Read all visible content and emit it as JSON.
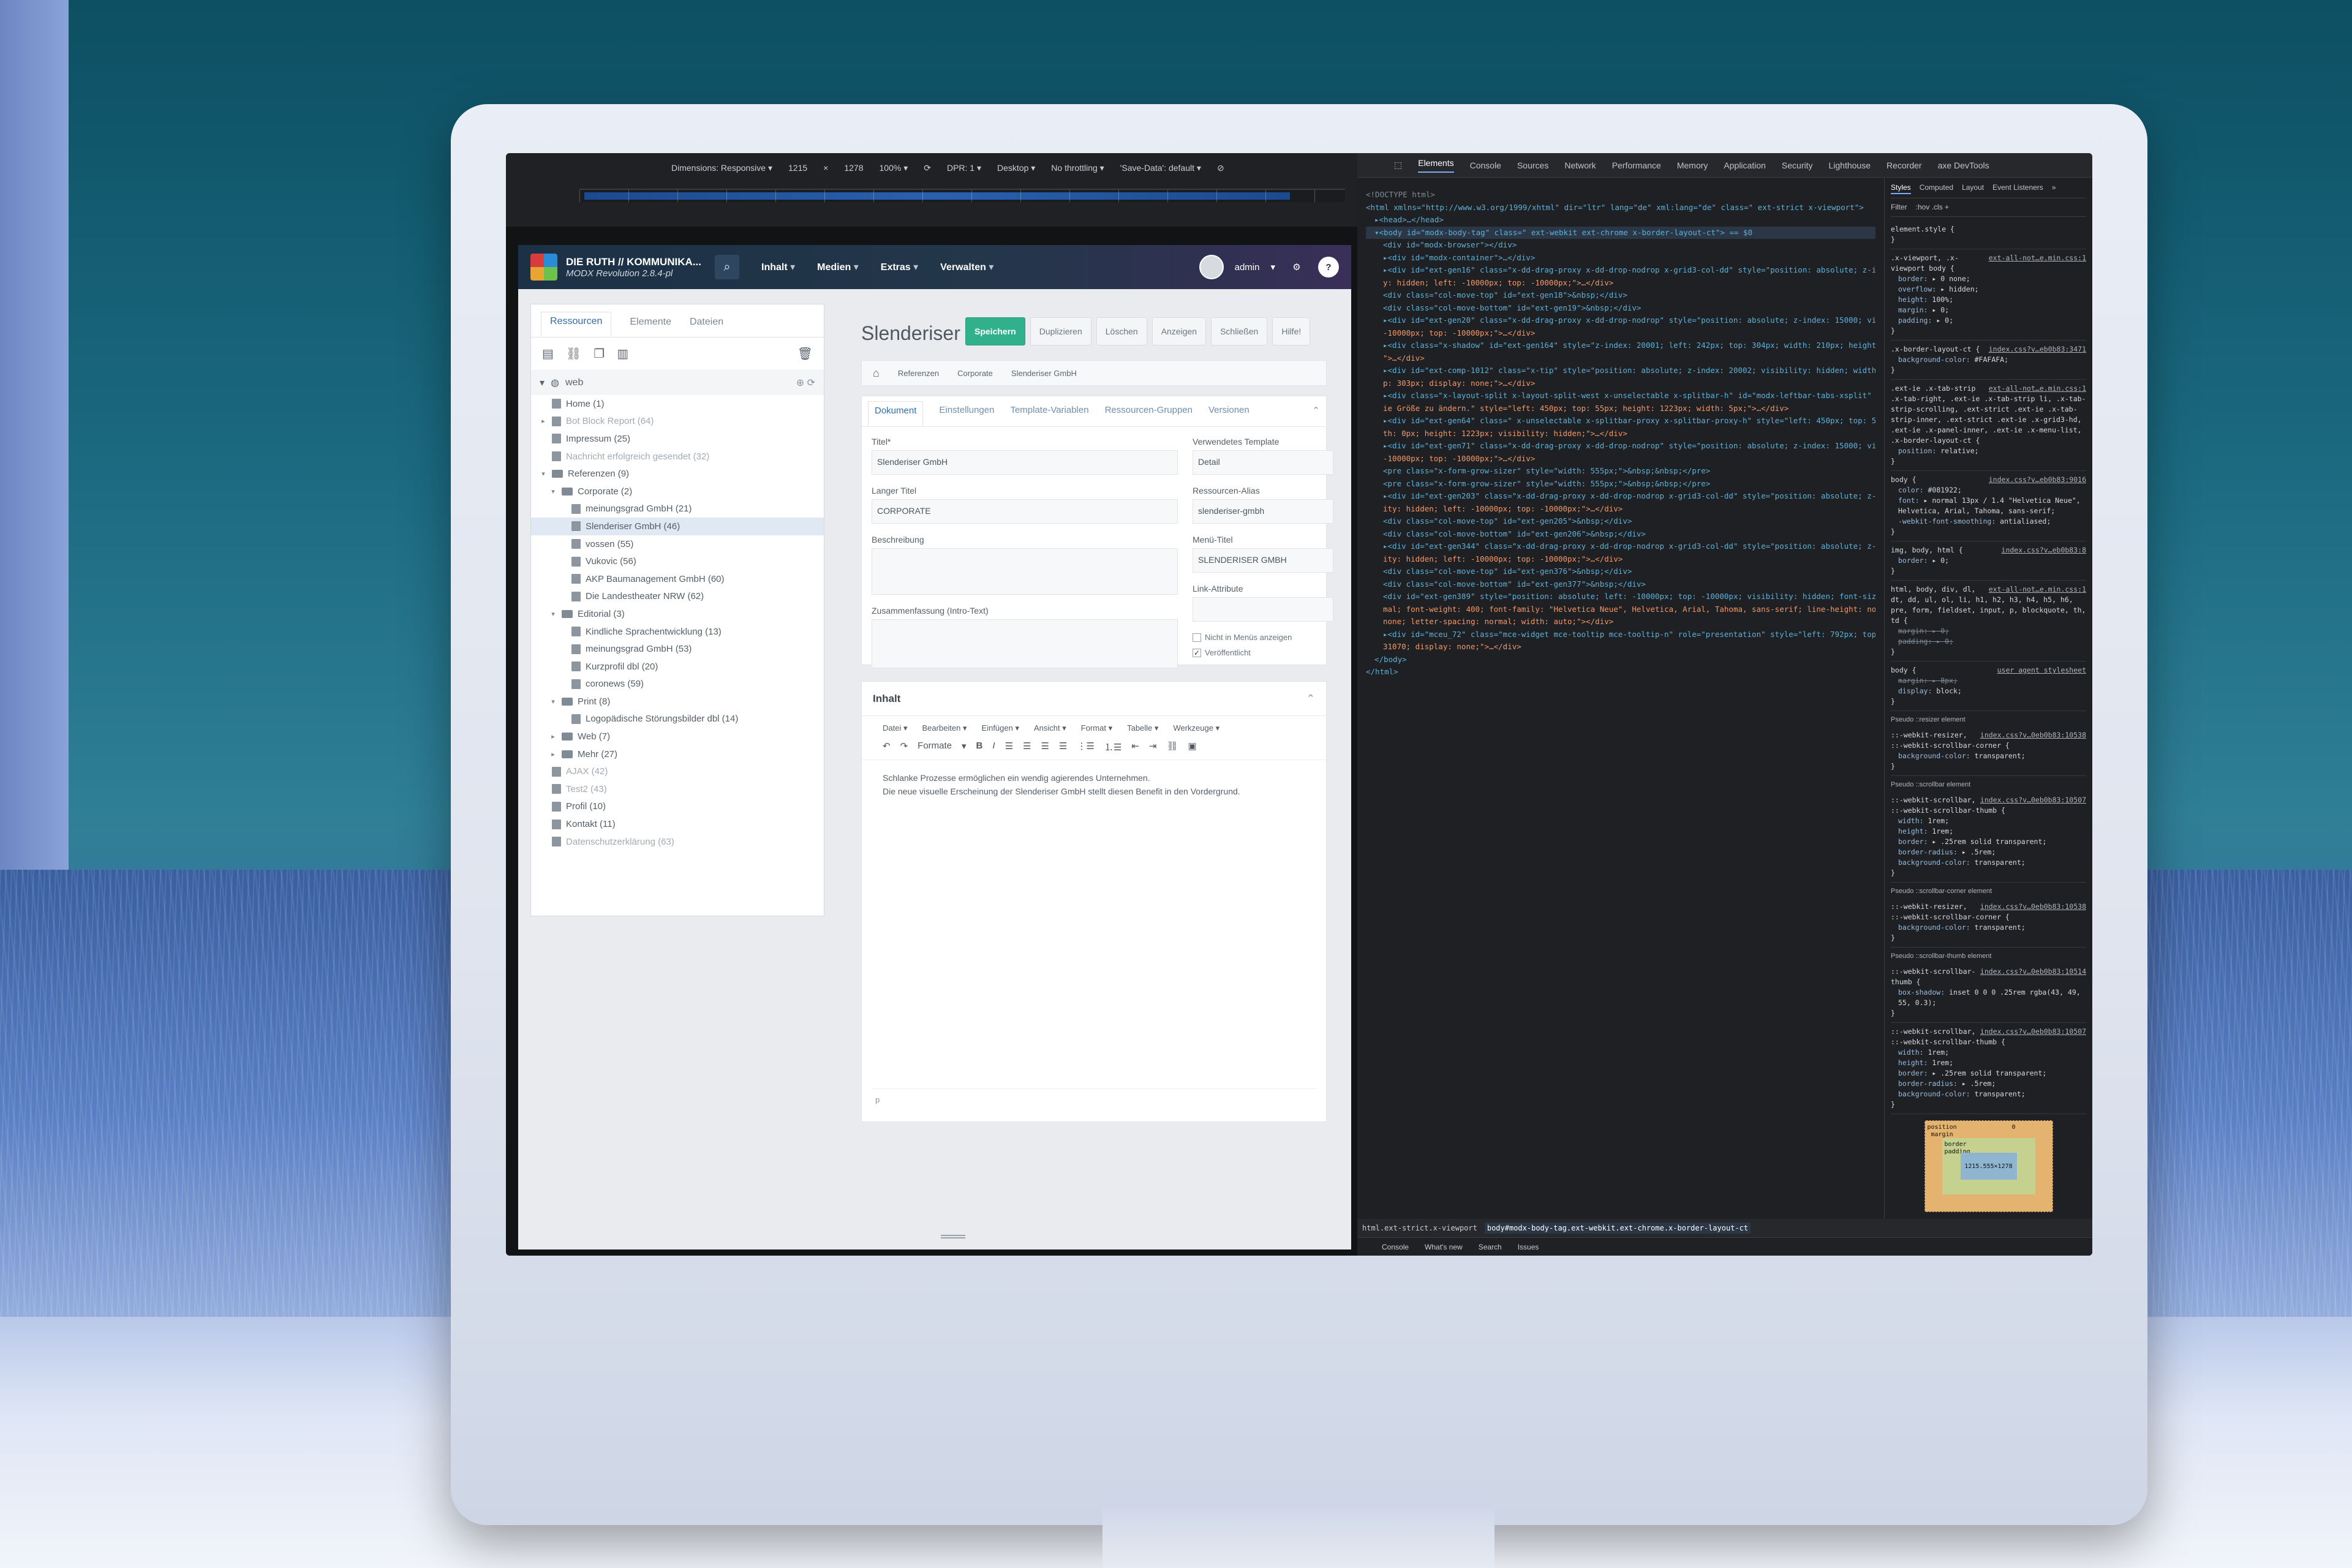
{
  "device_toolbar": {
    "dimensions_label": "Dimensions: Responsive ▾",
    "width": "1215",
    "times": "×",
    "height": "1278",
    "zoom": "100% ▾",
    "dpr": "DPR: 1 ▾",
    "device_type": "Desktop ▾",
    "throttling": "No throttling ▾",
    "save_data": "'Save-Data': default ▾"
  },
  "modx": {
    "brand_title": "DIE RUTH // KOMMUNIKA...",
    "brand_version": "MODX Revolution 2.8.4-pl",
    "nav": [
      "Inhalt",
      "Medien",
      "Extras",
      "Verwalten"
    ],
    "user": "admin",
    "help": "?"
  },
  "left_panel": {
    "tabs": [
      "Ressourcen",
      "Elemente",
      "Dateien"
    ],
    "root": "web",
    "tree": [
      {
        "label": "Home (1)",
        "level": 0,
        "type": "page",
        "muted": false,
        "arrow": ""
      },
      {
        "label": "Bot Block Report (64)",
        "level": 0,
        "type": "page",
        "muted": true,
        "arrow": "▸"
      },
      {
        "label": "Impressum (25)",
        "level": 0,
        "type": "page",
        "muted": false,
        "arrow": ""
      },
      {
        "label": "Nachricht erfolgreich gesendet (32)",
        "level": 0,
        "type": "page",
        "muted": true,
        "arrow": ""
      },
      {
        "label": "Referenzen (9)",
        "level": 0,
        "type": "folder",
        "muted": false,
        "arrow": "▾"
      },
      {
        "label": "Corporate (2)",
        "level": 1,
        "type": "folder",
        "muted": false,
        "arrow": "▾"
      },
      {
        "label": "meinungsgrad GmbH (21)",
        "level": 2,
        "type": "page",
        "muted": false,
        "arrow": ""
      },
      {
        "label": "Slenderiser GmbH (46)",
        "level": 2,
        "type": "page",
        "muted": false,
        "arrow": "",
        "selected": true
      },
      {
        "label": "vossen (55)",
        "level": 2,
        "type": "page",
        "muted": false,
        "arrow": ""
      },
      {
        "label": "Vukovic (56)",
        "level": 2,
        "type": "page",
        "muted": false,
        "arrow": ""
      },
      {
        "label": "AKP Baumanagement GmbH (60)",
        "level": 2,
        "type": "page",
        "muted": false,
        "arrow": ""
      },
      {
        "label": "Die Landestheater NRW (62)",
        "level": 2,
        "type": "page",
        "muted": false,
        "arrow": ""
      },
      {
        "label": "Editorial (3)",
        "level": 1,
        "type": "folder",
        "muted": false,
        "arrow": "▾"
      },
      {
        "label": "Kindliche Sprachentwicklung (13)",
        "level": 2,
        "type": "page",
        "muted": false,
        "arrow": ""
      },
      {
        "label": "meinungsgrad GmbH (53)",
        "level": 2,
        "type": "page",
        "muted": false,
        "arrow": ""
      },
      {
        "label": "Kurzprofil dbl (20)",
        "level": 2,
        "type": "page",
        "muted": false,
        "arrow": ""
      },
      {
        "label": "coronews (59)",
        "level": 2,
        "type": "page",
        "muted": false,
        "arrow": ""
      },
      {
        "label": "Print (8)",
        "level": 1,
        "type": "folder",
        "muted": false,
        "arrow": "▾"
      },
      {
        "label": "Logopädische Störungsbilder dbl (14)",
        "level": 2,
        "type": "page",
        "muted": false,
        "arrow": ""
      },
      {
        "label": "Web (7)",
        "level": 1,
        "type": "folder",
        "muted": false,
        "arrow": "▸"
      },
      {
        "label": "Mehr (27)",
        "level": 1,
        "type": "folder",
        "muted": false,
        "arrow": "▸"
      },
      {
        "label": "AJAX (42)",
        "level": 0,
        "type": "page",
        "muted": true,
        "arrow": ""
      },
      {
        "label": "Test2 (43)",
        "level": 0,
        "type": "page",
        "muted": true,
        "arrow": ""
      },
      {
        "label": "Profil (10)",
        "level": 0,
        "type": "page",
        "muted": false,
        "arrow": ""
      },
      {
        "label": "Kontakt (11)",
        "level": 0,
        "type": "page",
        "muted": false,
        "arrow": ""
      },
      {
        "label": "Datenschutzerklärung (63)",
        "level": 0,
        "type": "page",
        "muted": true,
        "arrow": ""
      }
    ]
  },
  "editor": {
    "title": "Slenderiser Gr",
    "actions": [
      "Speichern",
      "Duplizieren",
      "Löschen",
      "Anzeigen",
      "Schließen",
      "Hilfe!"
    ],
    "breadcrumbs": [
      "Referenzen",
      "Corporate",
      "Slenderiser GmbH"
    ],
    "tabs": [
      "Dokument",
      "Einstellungen",
      "Template-Variablen",
      "Ressourcen-Gruppen",
      "Versionen"
    ],
    "fields": {
      "titel_label": "Titel*",
      "titel_value": "Slenderiser GmbH",
      "langer_titel_label": "Langer Titel",
      "langer_titel_value": "CORPORATE",
      "beschreibung_label": "Beschreibung",
      "zusammenfassung_label": "Zusammenfassung (Intro-Text)",
      "template_label": "Verwendetes Template",
      "template_value": "Detail",
      "alias_label": "Ressourcen-Alias",
      "alias_value": "slenderiser-gmbh",
      "menutitel_label": "Menü-Titel",
      "menutitel_value": "SLENDERISER GMBH",
      "link_attr_label": "Link-Attribute",
      "hide_menu_label": "Nicht in Menüs anzeigen",
      "published_label": "Veröffentlicht"
    },
    "content": {
      "heading": "Inhalt",
      "menu": [
        "Datei",
        "Bearbeiten",
        "Einfügen",
        "Ansicht",
        "Format",
        "Tabelle",
        "Werkzeuge"
      ],
      "formats_label": "Formate",
      "paragraphs": [
        "Schlanke Prozesse ermöglichen ein wendig agierendes Unternehmen.",
        "Die neue visuelle Erscheinung der Slenderiser GmbH stellt diesen Benefit in den Vordergrund."
      ],
      "status_path": "p"
    }
  },
  "devtools": {
    "tabs": [
      "Elements",
      "Console",
      "Sources",
      "Network",
      "Performance",
      "Memory",
      "Application",
      "Security",
      "Lighthouse",
      "Recorder",
      "axe DevTools"
    ],
    "style_tabs": [
      "Styles",
      "Computed",
      "Layout",
      "Event Listeners",
      "»"
    ],
    "filter_placeholder": "Filter",
    "filter_extras": ":hov .cls +",
    "dom_lines": [
      {
        "indent": 0,
        "kind": "cm",
        "text": "<!DOCTYPE html>"
      },
      {
        "indent": 0,
        "kind": "tag",
        "text": "<html xmlns=\"http://www.w3.org/1999/xhtml\" dir=\"ltr\" lang=\"de\" xml:lang=\"de\" class=\" ext-strict x-viewport\">"
      },
      {
        "indent": 1,
        "kind": "tag",
        "text": "▸<head>…</head>"
      },
      {
        "indent": 1,
        "kind": "sel",
        "text": "▾<body id=\"modx-body-tag\" class=\" ext-webkit ext-chrome x-border-layout-ct\"> == $0"
      },
      {
        "indent": 2,
        "kind": "tag",
        "text": "<div id=\"modx-browser\"></div>"
      },
      {
        "indent": 2,
        "kind": "tag",
        "text": "▸<div id=\"modx-container\">…</div>"
      },
      {
        "indent": 2,
        "kind": "tag",
        "text": "▸<div id=\"ext-gen16\" class=\"x-dd-drag-proxy x-dd-drop-nodrop x-grid3-col-dd\" style=\"position: absolute; z-index: 15000; visibility"
      },
      {
        "indent": 2,
        "kind": "val",
        "text": "y: hidden; left: -10000px; top: -10000px;\">…</div>"
      },
      {
        "indent": 2,
        "kind": "tag",
        "text": "<div class=\"col-move-top\" id=\"ext-gen18\">&nbsp;</div>"
      },
      {
        "indent": 2,
        "kind": "tag",
        "text": "<div class=\"col-move-bottom\" id=\"ext-gen19\">&nbsp;</div>"
      },
      {
        "indent": 2,
        "kind": "tag",
        "text": "▸<div id=\"ext-gen20\" class=\"x-dd-drag-proxy x-dd-drop-nodrop\" style=\"position: absolute; z-index: 15000; visibility: hidden; left"
      },
      {
        "indent": 2,
        "kind": "val",
        "text": "-10000px; top: -10000px;\">…</div>"
      },
      {
        "indent": 2,
        "kind": "tag",
        "text": "▸<div class=\"x-shadow\" id=\"ext-gen164\" style=\"z-index: 20001; left: 242px; top: 304px; width: 210px; height: 30px; display: none;"
      },
      {
        "indent": 2,
        "kind": "val",
        "text": "\">…</div>"
      },
      {
        "indent": 2,
        "kind": "tag",
        "text": "▸<div id=\"ext-comp-1012\" class=\"x-tip\" style=\"position: absolute; z-index: 20002; visibility: hidden; width: 45px; left: 239px; to"
      },
      {
        "indent": 2,
        "kind": "val",
        "text": "p: 303px; display: none;\">…</div>"
      },
      {
        "indent": 2,
        "kind": "tag",
        "text": "▸<div class=\"x-layout-split x-layout-split-west x-unselectable x-splitbar-h\" id=\"modx-leftbar-tabs-xsplit\" title=\"Ziehen Sie, um d"
      },
      {
        "indent": 2,
        "kind": "val",
        "text": "ie Größe zu ändern.\" style=\"left: 450px; top: 55px; height: 1223px; width: 5px;\">…</div>"
      },
      {
        "indent": 2,
        "kind": "tag",
        "text": "▸<div id=\"ext-gen64\" class=\" x-unselectable x-splitbar-proxy x-splitbar-proxy-h\" style=\"left: 450px; top: 55px; display: none; wid"
      },
      {
        "indent": 2,
        "kind": "val",
        "text": "th: 0px; height: 1223px; visibility: hidden;\">…</div>"
      },
      {
        "indent": 2,
        "kind": "tag",
        "text": "▸<div id=\"ext-gen71\" class=\"x-dd-drag-proxy x-dd-drop-nodrop\" style=\"position: absolute; z-index: 15000; visibility: hidden; left:"
      },
      {
        "indent": 2,
        "kind": "val",
        "text": "-10000px; top: -10000px;\">…</div>"
      },
      {
        "indent": 2,
        "kind": "tag",
        "text": "<pre class=\"x-form-grow-sizer\" style=\"width: 555px;\">&nbsp;&nbsp;</pre>"
      },
      {
        "indent": 2,
        "kind": "tag",
        "text": "<pre class=\"x-form-grow-sizer\" style=\"width: 555px;\">&nbsp;&nbsp;</pre>"
      },
      {
        "indent": 2,
        "kind": "tag",
        "text": "▸<div id=\"ext-gen203\" class=\"x-dd-drag-proxy x-dd-drop-nodrop x-grid3-col-dd\" style=\"position: absolute; z-index: 15000; visibil"
      },
      {
        "indent": 2,
        "kind": "val",
        "text": "ity: hidden; left: -10000px; top: -10000px;\">…</div>"
      },
      {
        "indent": 2,
        "kind": "tag",
        "text": "<div class=\"col-move-top\" id=\"ext-gen205\">&nbsp;</div>"
      },
      {
        "indent": 2,
        "kind": "tag",
        "text": "<div class=\"col-move-bottom\" id=\"ext-gen206\">&nbsp;</div>"
      },
      {
        "indent": 2,
        "kind": "tag",
        "text": "▸<div id=\"ext-gen344\" class=\"x-dd-drag-proxy x-dd-drop-nodrop x-grid3-col-dd\" style=\"position: absolute; z-index: 15000; visibil"
      },
      {
        "indent": 2,
        "kind": "val",
        "text": "ity: hidden; left: -10000px; top: -10000px;\">…</div>"
      },
      {
        "indent": 2,
        "kind": "tag",
        "text": "<div class=\"col-move-top\" id=\"ext-gen376\">&nbsp;</div>"
      },
      {
        "indent": 2,
        "kind": "tag",
        "text": "<div class=\"col-move-bottom\" id=\"ext-gen377\">&nbsp;</div>"
      },
      {
        "indent": 2,
        "kind": "tag",
        "text": "<div id=\"ext-gen389\" style=\"position: absolute; left: -10000px; top: -10000px; visibility: hidden; font-size: 13px; font-style: nor"
      },
      {
        "indent": 2,
        "kind": "val",
        "text": "mal; font-weight: 400; font-family: \"Helvetica Neue\", Helvetica, Arial, Tahoma, sans-serif; line-height: normal; text-transform:"
      },
      {
        "indent": 2,
        "kind": "val",
        "text": "none; letter-spacing: normal; width: auto;\"></div>"
      },
      {
        "indent": 2,
        "kind": "tag",
        "text": "▸<div id=\"mceu_72\" class=\"mce-widget mce-tooltip mce-tooltip-n\" role=\"presentation\" style=\"left: 792px; top: 240.333px; z-index: 1"
      },
      {
        "indent": 2,
        "kind": "val",
        "text": "31070; display: none;\">…</div>"
      },
      {
        "indent": 1,
        "kind": "tag",
        "text": "</body>"
      },
      {
        "indent": 0,
        "kind": "tag",
        "text": "</html>"
      }
    ],
    "style_rules": [
      {
        "selector": "element.style {",
        "source": "",
        "props": [],
        "close": "}"
      },
      {
        "selector": ".x-viewport, .x-viewport body {",
        "source": "ext-all-not…e.min.css:1",
        "props": [
          [
            "border",
            "▸ 0 none;"
          ],
          [
            "overflow",
            "▸ hidden;"
          ],
          [
            "height",
            "100%;"
          ],
          [
            "margin",
            "▸ 0;"
          ],
          [
            "padding",
            "▸ 0;"
          ]
        ],
        "close": "}"
      },
      {
        "selector": ".x-border-layout-ct {",
        "source": "index.css?v…eb0b83:3471",
        "props": [
          [
            "background-color",
            "#FAFAFA;"
          ]
        ],
        "close": "}"
      },
      {
        "selector": ".ext-ie .x-tab-strip .x-tab-right, .ext-ie .x-tab-strip li, .x-tab-strip-scrolling, .ext-strict .ext-ie .x-tab-strip-inner, .ext-strict .ext-ie .x-grid3-hd, .ext-ie .x-panel-inner, .ext-ie .x-menu-list, .x-border-layout-ct {",
        "source": "ext-all-not…e.min.css:1",
        "props": [
          [
            "position",
            "relative;"
          ]
        ],
        "close": "}"
      },
      {
        "selector": "body {",
        "source": "index.css?v…eb0b83:9016",
        "props": [
          [
            "color",
            "#081922;"
          ],
          [
            "font",
            "▸ normal 13px / 1.4 \"Helvetica Neue\", Helvetica, Arial, Tahoma, sans-serif;"
          ],
          [
            "-webkit-font-smoothing",
            "antialiased;"
          ]
        ],
        "close": "}"
      },
      {
        "selector": "img, body, html {",
        "source": "index.css?v…eb0b83:8",
        "props": [
          [
            "border",
            "▸ 0;"
          ]
        ],
        "close": "}"
      },
      {
        "selector": "html, body, div, dl, dt, dd, ul, ol, li, h1, h2, h3, h4, h5, h6, pre, form, fieldset, input, p, blockquote, th, td {",
        "source": "ext-all-not…e.min.css:1",
        "strike": [
          [
            "margin",
            "▸ 0;"
          ],
          [
            "padding",
            "▸ 0;"
          ]
        ],
        "props": [],
        "close": "}"
      },
      {
        "selector": "body {",
        "source": "user agent stylesheet",
        "props": [
          [
            "display",
            "block;"
          ]
        ],
        "strike": [
          [
            "margin",
            "▸ 8px;"
          ]
        ],
        "close": "}"
      }
    ],
    "pseudo_sections": [
      {
        "heading": "Pseudo ::resizer element",
        "selector": "::-webkit-resizer, ::-webkit-scrollbar-corner {",
        "source": "index.css?v…0eb0b83:10538",
        "props": [
          [
            "background-color",
            "transparent;"
          ]
        ]
      },
      {
        "heading": "Pseudo ::scrollbar element",
        "selector": "::-webkit-scrollbar, ::-webkit-scrollbar-thumb {",
        "source": "index.css?v…0eb0b83:10507",
        "props": [
          [
            "width",
            "1rem;"
          ],
          [
            "height",
            "1rem;"
          ],
          [
            "border",
            "▸ .25rem solid transparent;"
          ],
          [
            "border-radius",
            "▸ .5rem;"
          ],
          [
            "background-color",
            "transparent;"
          ]
        ]
      },
      {
        "heading": "Pseudo ::scrollbar-corner element",
        "selector": "::-webkit-resizer, ::-webkit-scrollbar-corner {",
        "source": "index.css?v…0eb0b83:10538",
        "props": [
          [
            "background-color",
            "transparent;"
          ]
        ]
      },
      {
        "heading": "Pseudo ::scrollbar-thumb element",
        "selector": "::-webkit-scrollbar-thumb {",
        "source": "index.css?v…0eb0b83:10514",
        "props": [
          [
            "box-shadow",
            "inset 0 0 0 .25rem rgba(43, 49, 55, 0.3);"
          ]
        ]
      }
    ],
    "scrollbar_rule": {
      "selector": "::-webkit-scrollbar, ::-webkit-scrollbar-thumb {",
      "source": "index.css?v…0eb0b83:10507",
      "props": [
        [
          "width",
          "1rem;"
        ],
        [
          "height",
          "1rem;"
        ],
        [
          "border",
          "▸ .25rem solid transparent;"
        ],
        [
          "border-radius",
          "▸ .5rem;"
        ],
        [
          "background-color",
          "transparent;"
        ]
      ]
    },
    "box_model": {
      "position_label": "position",
      "position_value": "0",
      "margin_label": "margin",
      "border_label": "border",
      "padding_label": "padding",
      "content": "1215.555×1278",
      "dash": "–"
    },
    "crumbs": [
      "html.ext-strict.x-viewport",
      "body#modx-body-tag.ext-webkit.ext-chrome.x-border-layout-ct"
    ],
    "drawer_tabs": [
      "Console",
      "What's new",
      "Search",
      "Issues"
    ]
  },
  "colors": {
    "accent_green": "#31b08c",
    "devtools_bg": "#1f2023",
    "link_blue": "#2f6ea8"
  }
}
